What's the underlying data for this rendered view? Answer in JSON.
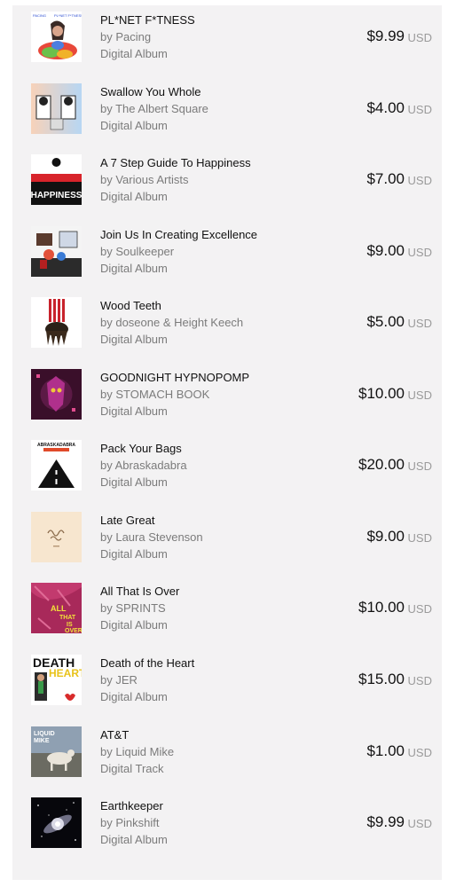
{
  "items": [
    {
      "title": "PL*NET F*TNESS",
      "artist": "by Pacing",
      "format": "Digital Album",
      "price": "$9.99",
      "currency": "USD",
      "cover": "album-cover-planet-fitness",
      "cover_text": "PACING  PL*NET F*TNESS"
    },
    {
      "title": "Swallow You Whole",
      "artist": "by The Albert Square",
      "format": "Digital Album",
      "price": "$4.00",
      "currency": "USD",
      "cover": "album-cover-swallow-you-whole"
    },
    {
      "title": "A 7 Step Guide To Happiness",
      "artist": "by Various Artists",
      "format": "Digital Album",
      "price": "$7.00",
      "currency": "USD",
      "cover": "album-cover-happiness",
      "cover_text": "HAPPINESS"
    },
    {
      "title": "Join Us In Creating Excellence",
      "artist": "by Soulkeeper",
      "format": "Digital Album",
      "price": "$9.00",
      "currency": "USD",
      "cover": "album-cover-soulkeeper"
    },
    {
      "title": "Wood Teeth",
      "artist": "by doseone & Height Keech",
      "format": "Digital Album",
      "price": "$5.00",
      "currency": "USD",
      "cover": "album-cover-wood-teeth"
    },
    {
      "title": "GOODNIGHT HYPNOPOMP",
      "artist": "by STOMACH BOOK",
      "format": "Digital Album",
      "price": "$10.00",
      "currency": "USD",
      "cover": "album-cover-goodnight-hypnopomp"
    },
    {
      "title": "Pack Your Bags",
      "artist": "by Abraskadabra",
      "format": "Digital Album",
      "price": "$20.00",
      "currency": "USD",
      "cover": "album-cover-pack-your-bags",
      "cover_text": "ABRASKADABRA"
    },
    {
      "title": "Late Great",
      "artist": "by Laura Stevenson",
      "format": "Digital Album",
      "price": "$9.00",
      "currency": "USD",
      "cover": "album-cover-late-great"
    },
    {
      "title": "All That Is Over",
      "artist": "by SPRINTS",
      "format": "Digital Album",
      "price": "$10.00",
      "currency": "USD",
      "cover": "album-cover-all-that-is-over",
      "cover_text": "ALL THAT IS OVER"
    },
    {
      "title": "Death of the Heart",
      "artist": "by JER",
      "format": "Digital Album",
      "price": "$15.00",
      "currency": "USD",
      "cover": "album-cover-death-of-the-heart",
      "cover_text": "DEATH HEART"
    },
    {
      "title": "AT&T",
      "artist": "by Liquid Mike",
      "format": "Digital Track",
      "price": "$1.00",
      "currency": "USD",
      "cover": "album-cover-att",
      "cover_text": "LIQUID MIKE"
    },
    {
      "title": "Earthkeeper",
      "artist": "by Pinkshift",
      "format": "Digital Album",
      "price": "$9.99",
      "currency": "USD",
      "cover": "album-cover-earthkeeper"
    }
  ]
}
